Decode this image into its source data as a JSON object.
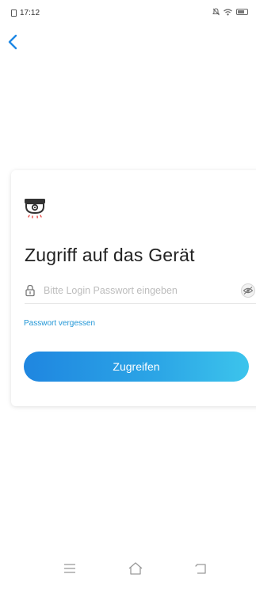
{
  "status_bar": {
    "time": "17:12",
    "icons": [
      "sim-icon",
      "mute-icon",
      "wifi-icon",
      "battery-icon"
    ]
  },
  "header": {
    "back_icon": "chevron-left-icon"
  },
  "card": {
    "device_icon": "dome-camera-icon",
    "title": "Zugriff auf das Gerät",
    "password_field": {
      "placeholder": "Bitte Login Passwort eingeben",
      "value": "",
      "lock_icon": "lock-icon",
      "toggle_icon": "eye-icon"
    },
    "forgot_link": "Passwort vergessen",
    "submit_label": "Zugreifen"
  },
  "nav_bar": {
    "items": [
      "menu-icon",
      "home-icon",
      "back-icon"
    ]
  },
  "colors": {
    "accent": "#2196d6",
    "button_start": "#1f86e0",
    "button_end": "#3cc4ec",
    "back_arrow": "#1e88e5"
  }
}
